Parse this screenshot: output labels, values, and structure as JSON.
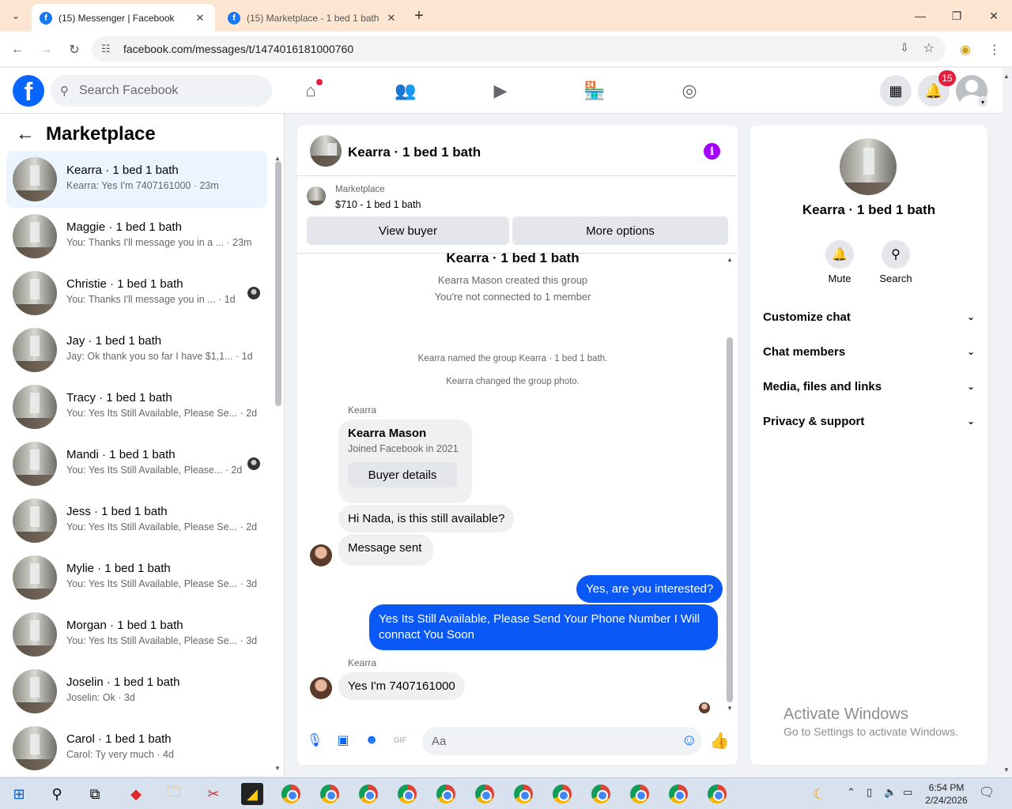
{
  "browser": {
    "tabs": [
      {
        "title": "(15) Messenger | Facebook",
        "active": true
      },
      {
        "title": "(15) Marketplace - 1 bed 1 bath",
        "active": false
      }
    ],
    "url": "facebook.com/messages/t/1474016181000760"
  },
  "fb_header": {
    "search_placeholder": "Search Facebook",
    "notifications_count": "15"
  },
  "left_panel": {
    "title": "Marketplace",
    "conversations": [
      {
        "name": "Kearra · 1 bed 1 bath",
        "preview": "Kearra: Yes I'm 7407161000 · 23m",
        "selected": true,
        "seen_avatar": false
      },
      {
        "name": "Maggie · 1 bed 1 bath",
        "preview": "You: Thanks I'll message you in a ... · 23m",
        "selected": false,
        "seen_avatar": false
      },
      {
        "name": "Christie · 1 bed 1 bath",
        "preview": "You: Thanks I'll message you in ... · 1d",
        "selected": false,
        "seen_avatar": true
      },
      {
        "name": "Jay · 1 bed 1 bath",
        "preview": "Jay: Ok thank you so far I have $1,1... · 1d",
        "selected": false,
        "seen_avatar": false
      },
      {
        "name": "Tracy · 1 bed 1 bath",
        "preview": "You: Yes Its Still Available, Please Se... · 2d",
        "selected": false,
        "seen_avatar": false
      },
      {
        "name": "Mandi · 1 bed 1 bath",
        "preview": "You: Yes Its Still Available, Please... · 2d",
        "selected": false,
        "seen_avatar": true
      },
      {
        "name": "Jess · 1 bed 1 bath",
        "preview": "You: Yes Its Still Available, Please Se... · 2d",
        "selected": false,
        "seen_avatar": false
      },
      {
        "name": "Mylie · 1 bed 1 bath",
        "preview": "You: Yes Its Still Available, Please Se... · 3d",
        "selected": false,
        "seen_avatar": false
      },
      {
        "name": "Morgan · 1 bed 1 bath",
        "preview": "You: Yes Its Still Available, Please Se... · 3d",
        "selected": false,
        "seen_avatar": false
      },
      {
        "name": "Joselin · 1 bed 1 bath",
        "preview": "Joselin: Ok · 3d",
        "selected": false,
        "seen_avatar": false
      },
      {
        "name": "Carol · 1 bed 1 bath",
        "preview": "Carol: Ty very much · 4d",
        "selected": false,
        "seen_avatar": false
      }
    ]
  },
  "chat": {
    "title": "Kearra · 1 bed 1 bath",
    "marketplace": {
      "label": "Marketplace",
      "price_title": "$710 - 1 bed 1 bath",
      "view_buyer": "View buyer",
      "more_options": "More options"
    },
    "group_title": "Kearra · 1 bed 1 bath",
    "group_created": "Kearra Mason created this group",
    "not_connected": "You're not connected to 1 member",
    "named_event": "Kearra named the group Kearra · 1 bed 1 bath.",
    "photo_event": "Kearra changed the group photo.",
    "sender1": "Kearra",
    "buyer_card": {
      "name": "Kearra Mason",
      "joined": "Joined Facebook in 2021",
      "button": "Buyer details"
    },
    "msg_in_1": "Hi Nada, is this still available?",
    "msg_in_2": "Message sent",
    "msg_out_1": "Yes, are you interested?",
    "msg_out_2": "Yes Its Still Available, Please Send Your Phone Number I Will connact You Soon",
    "sender2": "Kearra",
    "msg_in_3": "Yes I'm 7407161000",
    "composer_placeholder": "Aa"
  },
  "right_panel": {
    "name": "Kearra · 1 bed 1 bath",
    "mute_label": "Mute",
    "search_label": "Search",
    "sections": [
      "Customize chat",
      "Chat members",
      "Media, files and links",
      "Privacy & support"
    ]
  },
  "activation": {
    "title": "Activate Windows",
    "subtitle": "Go to Settings to activate Windows."
  },
  "taskbar": {
    "time": "6:54 PM",
    "date": "2/24/2026"
  }
}
